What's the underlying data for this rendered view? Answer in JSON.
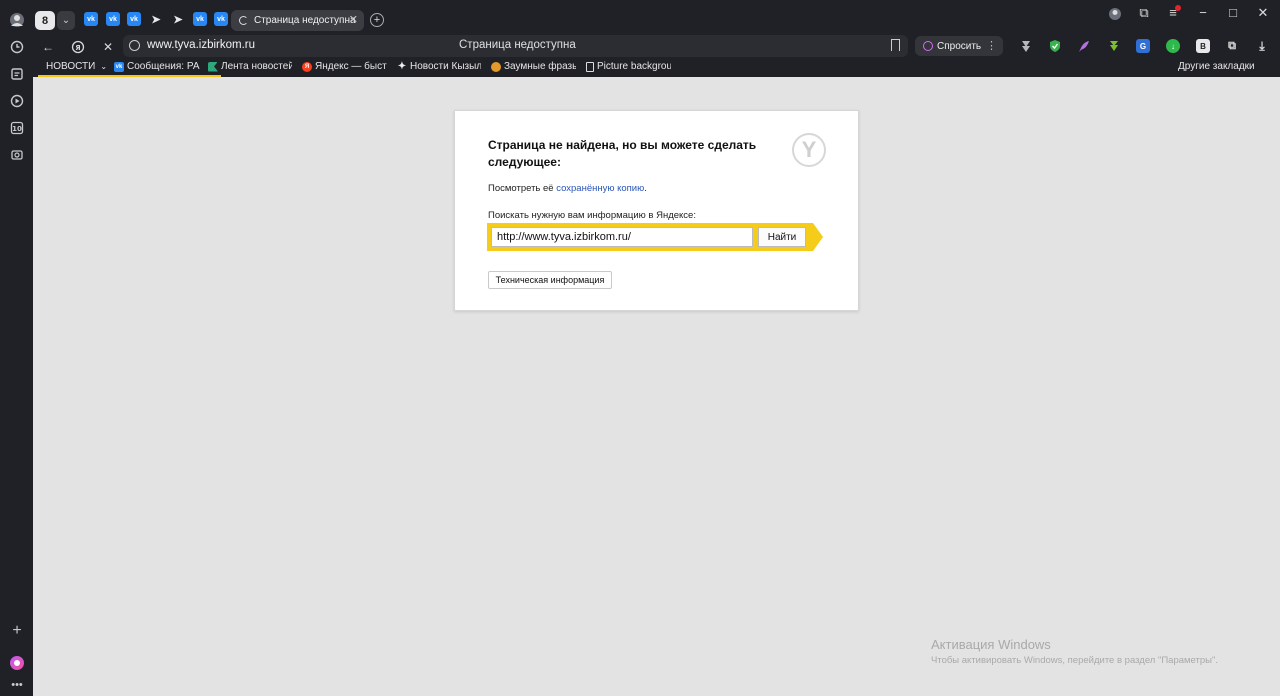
{
  "tabs": {
    "count": "8",
    "active_title": "Страница недоступна"
  },
  "toolbar": {
    "url": "www.tyva.izbirkom.ru",
    "page_title": "Страница недоступна",
    "ask_label": "Спросить"
  },
  "bookmarks": {
    "items": [
      {
        "label": "НОВОСТИ",
        "icon": "chevron-down-icon"
      },
      {
        "label": "Сообщения: РАБС",
        "icon": "vk-icon"
      },
      {
        "label": "Лента новостей и",
        "icon": "flag-icon"
      },
      {
        "label": "Яндекс — быстрь",
        "icon": "yandex-icon"
      },
      {
        "label": "Новости Кызыла",
        "icon": "star-icon"
      },
      {
        "label": "Заумные фразы і",
        "icon": "hotdog-icon"
      },
      {
        "label": "Picture backgroun",
        "icon": "doc-icon"
      }
    ],
    "other": "Другие закладки"
  },
  "error_page": {
    "heading": "Страница не найдена, но вы можете сделать следующее:",
    "saved_prefix": "Посмотреть её ",
    "saved_link": "сохранённую копию",
    "saved_suffix": ".",
    "search_label": "Поискать нужную вам информацию в Яндексе:",
    "search_value": "http://www.tyva.izbirkom.ru/",
    "find_label": "Найти",
    "tech_label": "Техническая информация"
  },
  "activation": {
    "title": "Активация Windows",
    "subtitle": "Чтобы активировать Windows, перейдите в раздел \"Параметры\"."
  },
  "colors": {
    "accent_yellow": "#f5cc1a",
    "link": "#2b55b8",
    "vk_blue": "#2787f5"
  }
}
